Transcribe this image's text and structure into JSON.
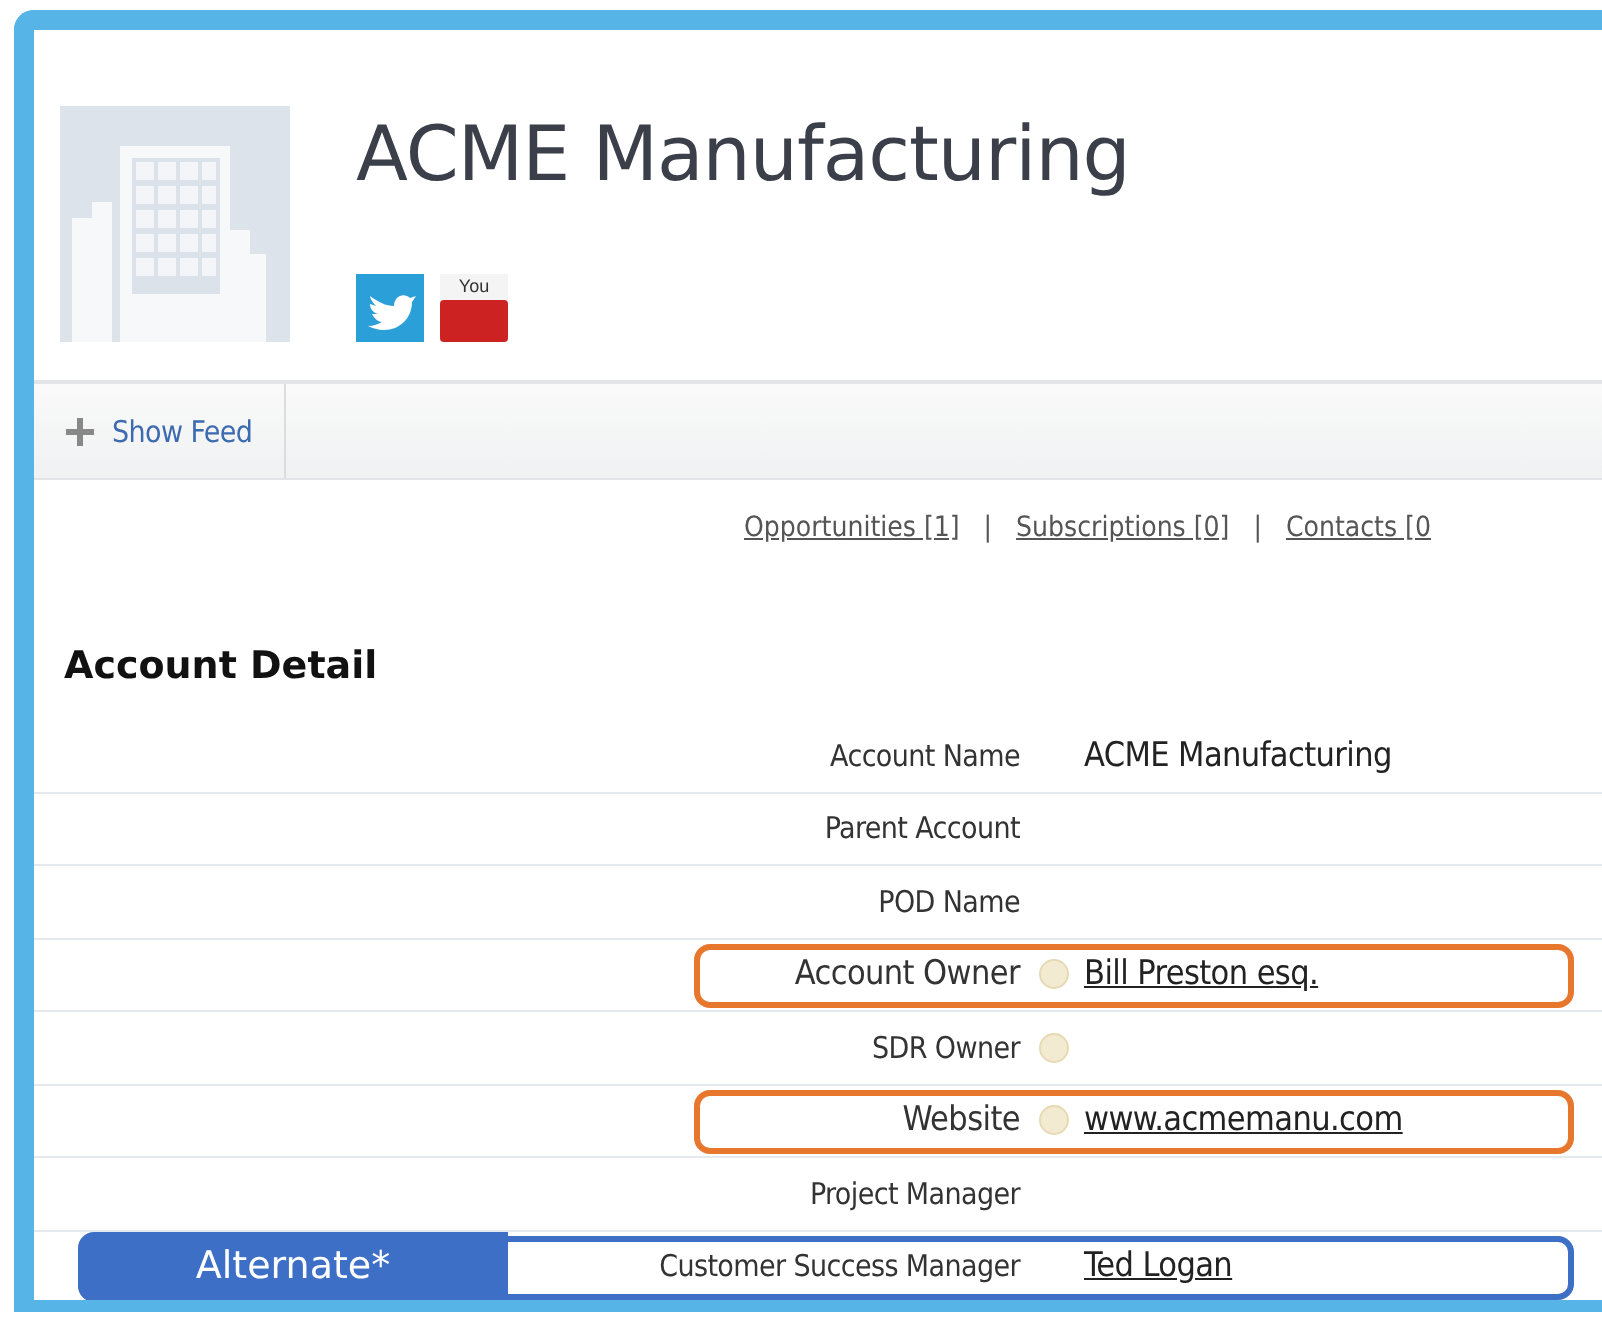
{
  "account": {
    "name": "ACME Manufacturing"
  },
  "social": [
    {
      "kind": "twitter"
    },
    {
      "kind": "youtube",
      "label": "You"
    }
  ],
  "toolbar": {
    "show_feed": "Show Feed"
  },
  "related_links": [
    {
      "label": "Opportunities [1]"
    },
    {
      "label": "Subscriptions [0]"
    },
    {
      "label": "Contacts [0"
    }
  ],
  "link_separator": "|",
  "section_title": "Account Detail",
  "fields": [
    {
      "label": "Account Name",
      "value": "ACME Manufacturing",
      "link": false,
      "info_icon": false,
      "kind": "plain"
    },
    {
      "label": "Parent Account",
      "info_icon": false,
      "kind": "plain"
    },
    {
      "label": "POD Name",
      "info_icon": false,
      "kind": "plain"
    },
    {
      "label": "Account Owner",
      "value": "Bill Preston esq.",
      "link": true,
      "info_icon": true,
      "kind": "highlighted"
    },
    {
      "label": "SDR Owner",
      "info_icon": true,
      "kind": "plain"
    },
    {
      "label": "Website",
      "value": "www.acmemanu.com",
      "link": true,
      "info_icon": true,
      "kind": "highlighted"
    },
    {
      "label": "Project Manager",
      "info_icon": false,
      "kind": "plain"
    },
    {
      "label": "Customer Success Manager",
      "value": "Ted Logan",
      "link": true,
      "info_icon": false,
      "kind": "alternate",
      "tag": "Alternate*"
    }
  ]
}
